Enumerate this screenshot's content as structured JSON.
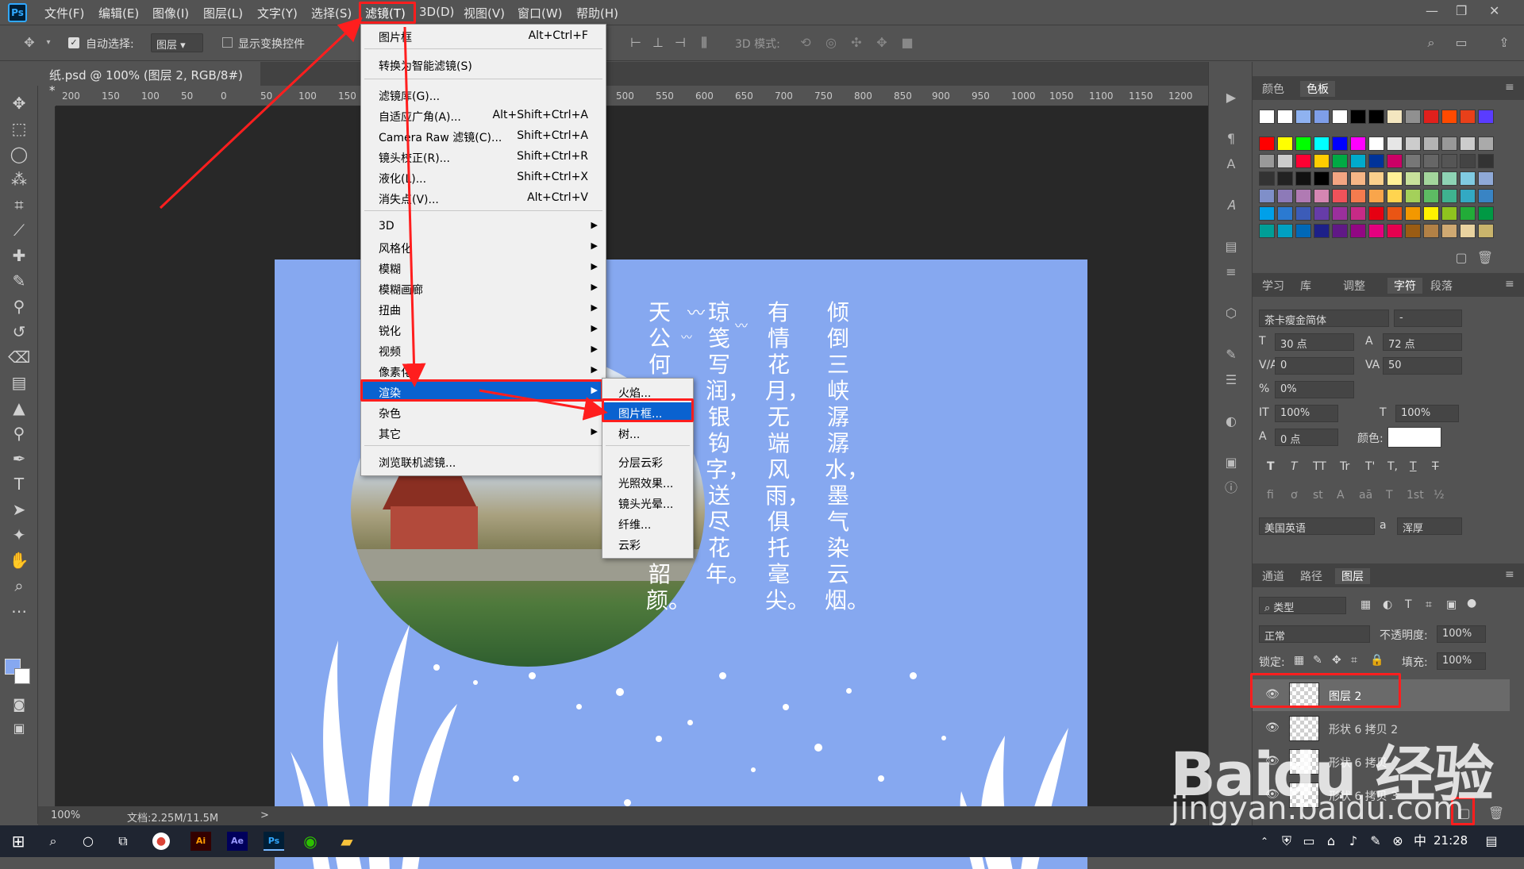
{
  "app": {
    "logo": "Ps"
  },
  "menubar": {
    "items": [
      "文件(F)",
      "编辑(E)",
      "图像(I)",
      "图层(L)",
      "文字(Y)",
      "选择(S)",
      "滤镜(T)",
      "3D(D)",
      "视图(V)",
      "窗口(W)",
      "帮助(H)"
    ]
  },
  "options": {
    "auto_select_label": "自动选择:",
    "auto_select_value": "图层",
    "transform_label": "显示变换控件",
    "mode3d_label": "3D 模式:"
  },
  "document": {
    "tab_title": "纸.psd @ 100% (图层 2, RGB/8#) *",
    "close": "×"
  },
  "ruler": {
    "ticks": [
      "200",
      "150",
      "100",
      "50",
      "0",
      "50",
      "100",
      "150",
      "500",
      "550",
      "600",
      "650",
      "700",
      "750",
      "800",
      "850",
      "900",
      "950",
      "1000",
      "1050",
      "1100",
      "1150",
      "1200"
    ]
  },
  "poem": {
    "columns": [
      "倾倒三峡潺潺水，墨气染云烟。",
      "有情花月，无端风雨，俱托毫尖。",
      "琼笺写润，银钩字，送尽花年。",
      "天公何事，从来酷妒，逸韵韶颜。"
    ]
  },
  "status": {
    "zoom": "100%",
    "doc": "文档:2.25M/11.5M",
    "arrow": ">"
  },
  "filter_menu": {
    "items": [
      {
        "label": "图片框",
        "shortcut": "Alt+Ctrl+F"
      },
      {
        "label": "转换为智能滤镜(S)",
        "shortcut": ""
      },
      {
        "label": "滤镜库(G)...",
        "shortcut": ""
      },
      {
        "label": "自适应广角(A)...",
        "shortcut": "Alt+Shift+Ctrl+A"
      },
      {
        "label": "Camera Raw 滤镜(C)...",
        "shortcut": "Shift+Ctrl+A"
      },
      {
        "label": "镜头校正(R)...",
        "shortcut": "Shift+Ctrl+R"
      },
      {
        "label": "液化(L)...",
        "shortcut": "Shift+Ctrl+X"
      },
      {
        "label": "消失点(V)...",
        "shortcut": "Alt+Ctrl+V"
      },
      {
        "label": "3D",
        "shortcut": ""
      },
      {
        "label": "风格化",
        "shortcut": ""
      },
      {
        "label": "模糊",
        "shortcut": ""
      },
      {
        "label": "模糊画廊",
        "shortcut": ""
      },
      {
        "label": "扭曲",
        "shortcut": ""
      },
      {
        "label": "锐化",
        "shortcut": ""
      },
      {
        "label": "视频",
        "shortcut": ""
      },
      {
        "label": "像素化",
        "shortcut": ""
      },
      {
        "label": "渲染",
        "shortcut": ""
      },
      {
        "label": "杂色",
        "shortcut": ""
      },
      {
        "label": "其它",
        "shortcut": ""
      },
      {
        "label": "浏览联机滤镜...",
        "shortcut": ""
      }
    ]
  },
  "render_submenu": {
    "items": [
      "火焰...",
      "图片框...",
      "树...",
      "分层云彩",
      "光照效果...",
      "镜头光晕...",
      "纤维...",
      "云彩"
    ]
  },
  "swatch_panel": {
    "tabs": [
      "颜色",
      "色板"
    ],
    "rows": [
      [
        "#ffffff",
        "#ffffff",
        "#8fb2f0",
        "#7e9ee8",
        "#ffffff",
        "#000000",
        "#000000",
        "#f3e6c0",
        "#909090",
        "#e0201c",
        "#ff4a00",
        "#e8401a",
        "#5a3cff"
      ],
      [
        "#ff0000",
        "#ffff00",
        "#00ff00",
        "#00ffff",
        "#0000ff",
        "#ff00ff",
        "#ffffff",
        "#e6e6e6",
        "#cccccc",
        "#b3b3b3",
        "#999999",
        "#cccccc",
        "#aaaaaa"
      ],
      [
        "#999999",
        "#cccccc",
        "#ff0033",
        "#ffcc00",
        "#00aa44",
        "#00aacc",
        "#003399",
        "#cc0066",
        "#777777",
        "#666666",
        "#555555",
        "#444444",
        "#333333"
      ],
      [
        "#333333",
        "#222222",
        "#111111",
        "#000000",
        "#f4a582",
        "#f7b686",
        "#fad08c",
        "#fff197",
        "#c8e19b",
        "#a3d59c",
        "#8ed3b4",
        "#80cbe2",
        "#8fa9d7"
      ],
      [
        "#7f8fc9",
        "#8d7ab8",
        "#b07ab3",
        "#d586b2",
        "#f0525a",
        "#f47b4e",
        "#f9a54b",
        "#ffd44f",
        "#a4d05a",
        "#5dbb63",
        "#3fb28f",
        "#33a9c3",
        "#3984c4"
      ],
      [
        "#00a0e9",
        "#2b7ad1",
        "#3c5cb8",
        "#663ca8",
        "#9b2f9c",
        "#c72a86",
        "#e60012",
        "#ea5514",
        "#f39800",
        "#fff100",
        "#8fc31f",
        "#22ac38",
        "#009944"
      ],
      [
        "#009e96",
        "#00a0c1",
        "#0068b7",
        "#1d2088",
        "#601986",
        "#920783",
        "#e4007f",
        "#e5004f",
        "#9a5c13",
        "#b28146",
        "#cfa972",
        "#e9d3a0",
        "#c9b46c"
      ]
    ]
  },
  "char_panel": {
    "tabs": [
      "学习",
      "库",
      "调整",
      "字符",
      "段落"
    ],
    "font_family": "茶卡瘦金简体",
    "font_style": "-",
    "font_size": "30 点",
    "leading": "72 点",
    "kerning": "0",
    "tracking": "50",
    "scale_pct": "0%",
    "vscale": "100%",
    "hscale": "100%",
    "baseline": "0 点",
    "color_label": "颜色:",
    "language": "美国英语",
    "aa_label": "a",
    "aa_value": "浑厚",
    "type_buttons": [
      "T",
      "T",
      "TT",
      "Tr",
      "T'",
      "T,",
      "T",
      "T"
    ],
    "ot_buttons": [
      "fi",
      "ơ",
      "st",
      "A",
      "aā",
      "T",
      "1st",
      "½"
    ]
  },
  "layers_panel": {
    "tabs": [
      "通道",
      "路径",
      "图层"
    ],
    "filter_label": "类型",
    "blend_mode": "正常",
    "opacity_label": "不透明度:",
    "opacity_value": "100%",
    "lock_label": "锁定:",
    "fill_label": "填充:",
    "fill_value": "100%",
    "layers": [
      "图层 2",
      "形状 6 拷贝 2",
      "形状 6 拷贝",
      "形状 6 拷贝 3"
    ]
  },
  "taskbar": {
    "clock": "21:28"
  },
  "watermark": {
    "logo": "Baidu 经验",
    "url": "jingyan.baidu.com"
  },
  "colors": {
    "accent": "#0a62d0",
    "highlight_red": "#ff1e1e",
    "canvas_bg": "#86a8f0"
  }
}
